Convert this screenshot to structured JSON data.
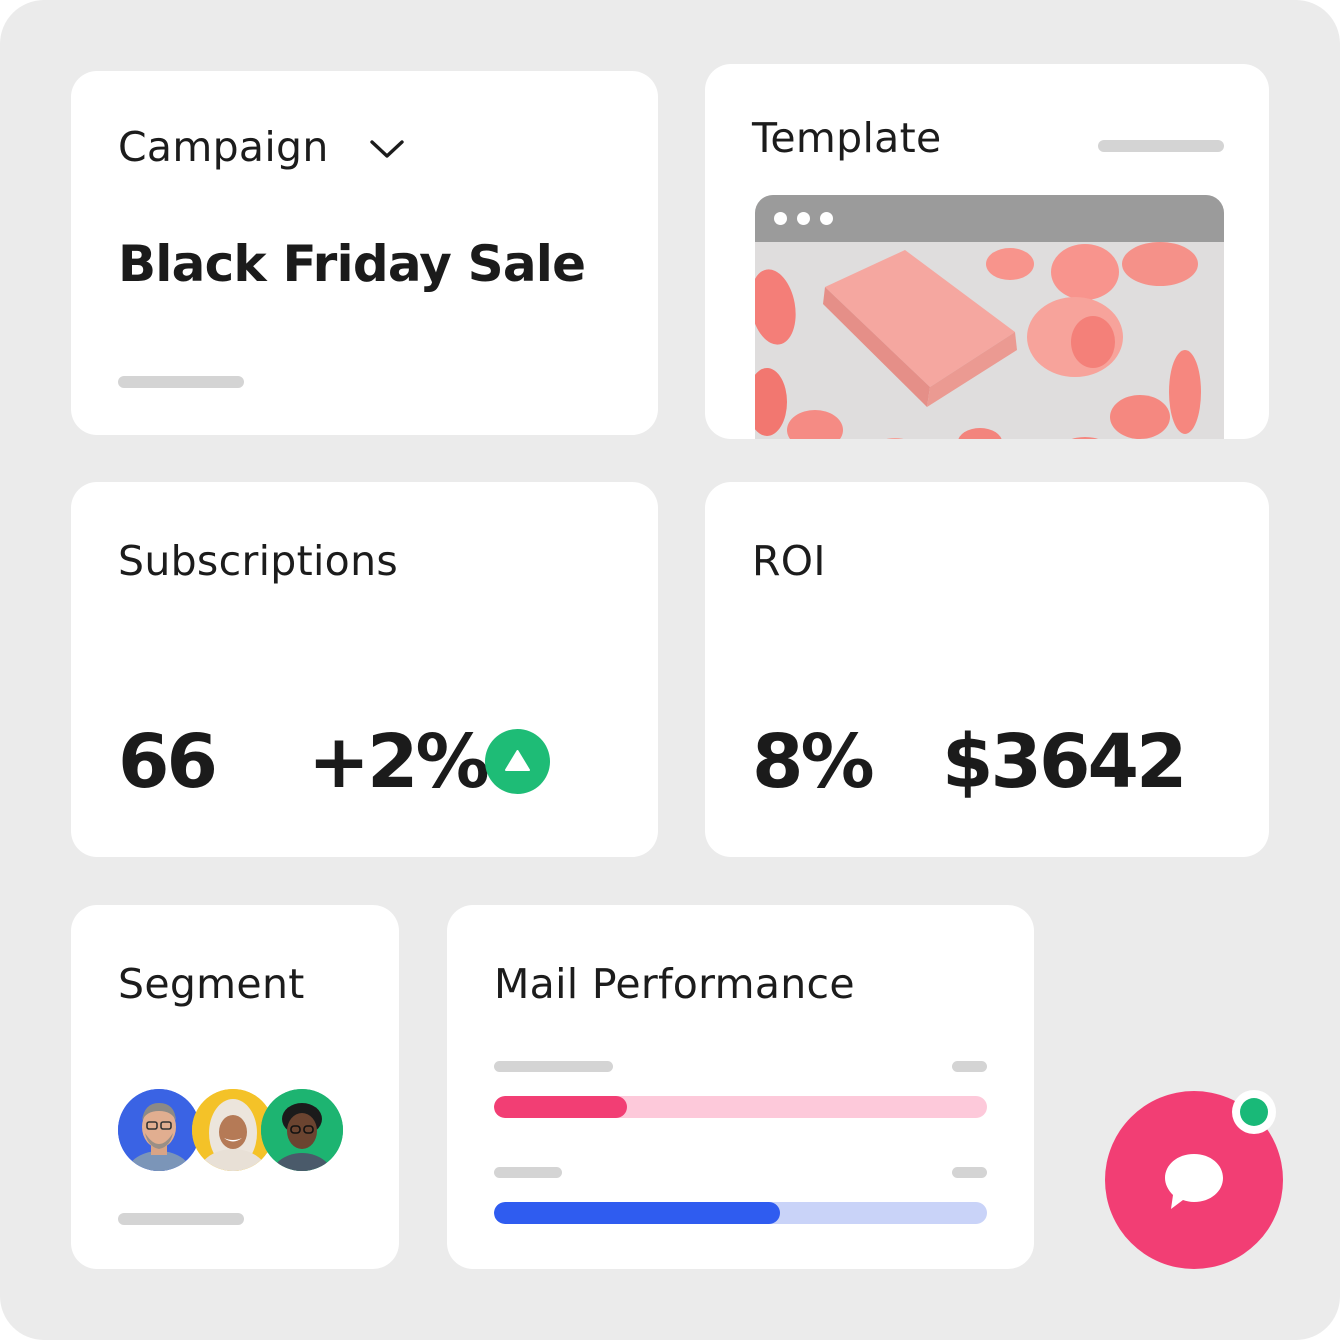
{
  "campaign": {
    "title": "Campaign",
    "name": "Black Friday Sale"
  },
  "template": {
    "title": "Template"
  },
  "subscriptions": {
    "title": "Subscriptions",
    "count": "66",
    "change": "+2%",
    "trend": "up"
  },
  "roi": {
    "title": "ROI",
    "percent": "8%",
    "amount": "$3642"
  },
  "segment": {
    "title": "Segment",
    "avatar_count": 3
  },
  "mail_performance": {
    "title": "Mail Performance",
    "bars": [
      {
        "progress": 0.27,
        "fill_color": "#f23e74",
        "track_color": "#fdc9da"
      },
      {
        "progress": 0.58,
        "fill_color": "#2f5cf0",
        "track_color": "#c9d3f8"
      }
    ]
  },
  "colors": {
    "background": "#ebebeb",
    "card": "#ffffff",
    "accent_pink": "#f23e74",
    "accent_green": "#1ebc76",
    "accent_blue": "#2f5cf0"
  },
  "icons": {
    "campaign_dropdown": "chevron-down-icon",
    "trend": "triangle-up-icon",
    "chat": "chat-bubble-icon"
  }
}
